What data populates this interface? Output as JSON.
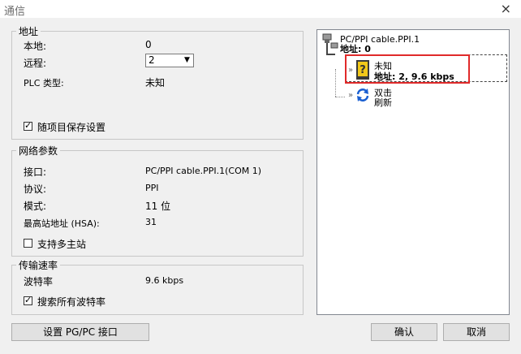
{
  "window": {
    "title": "通信",
    "close_label": "×"
  },
  "address_group": {
    "legend": "地址",
    "local_label": "本地:",
    "local_value": "0",
    "remote_label": "远程:",
    "remote_value": "2",
    "plc_type_label": "PLC 类型:",
    "plc_type_value": "未知",
    "save_with_project_label": "随项目保存设置",
    "save_with_project_checked": true
  },
  "network_group": {
    "legend": "网络参数",
    "interface_label": "接口:",
    "interface_value": "PC/PPI cable.PPI.1(COM 1)",
    "protocol_label": "协议:",
    "protocol_value": "PPI",
    "mode_label": "模式:",
    "mode_value": "11 位",
    "hsa_label": "最高站地址 (HSA):",
    "hsa_value": "31",
    "multi_master_label": "支持多主站",
    "multi_master_checked": false
  },
  "baud_group": {
    "legend": "传输速率",
    "baud_label": "波特率",
    "baud_value": "9.6 kbps",
    "search_all_label": "搜索所有波特率",
    "search_all_checked": true
  },
  "tree": {
    "cable_name": "PC/PPI cable.PPI.1",
    "cable_address": "地址: 0",
    "device_name": "未知",
    "device_address": "地址: 2, 9.6 kbps",
    "refresh_line1": "双击",
    "refresh_line2": "刷新"
  },
  "buttons": {
    "setup_pgpc": "设置 PG/PC 接口",
    "ok": "确认",
    "cancel": "取消"
  },
  "colors": {
    "highlight_box": "#e02a2a",
    "refresh_icon": "#1a5fd1",
    "device_icon": "#f2c81a"
  }
}
